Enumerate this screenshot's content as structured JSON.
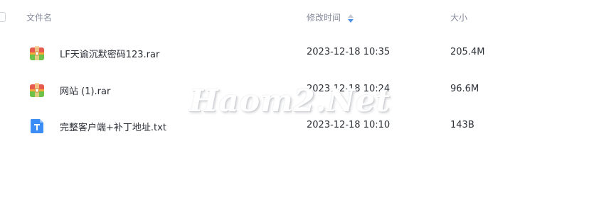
{
  "columns": {
    "name": "文件名",
    "modified": "修改时间",
    "size": "大小"
  },
  "files": [
    {
      "name": "LF天谕沉默密码123.rar",
      "modified": "2023-12-18 10:35",
      "size": "205.4M",
      "icon": "rar-archive-icon"
    },
    {
      "name": "网站 (1).rar",
      "modified": "2023-12-18 10:24",
      "size": "96.6M",
      "icon": "rar-archive-icon"
    },
    {
      "name": "完整客户端+补丁地址.txt",
      "modified": "2023-12-18 10:10",
      "size": "143B",
      "icon": "txt-document-icon"
    }
  ],
  "watermark": "Haom2.Net",
  "colors": {
    "header_text": "#878c9c",
    "body_text": "#2b2f36",
    "sort_active": "#4a90e2",
    "txt_icon": "#3b8cf5"
  }
}
